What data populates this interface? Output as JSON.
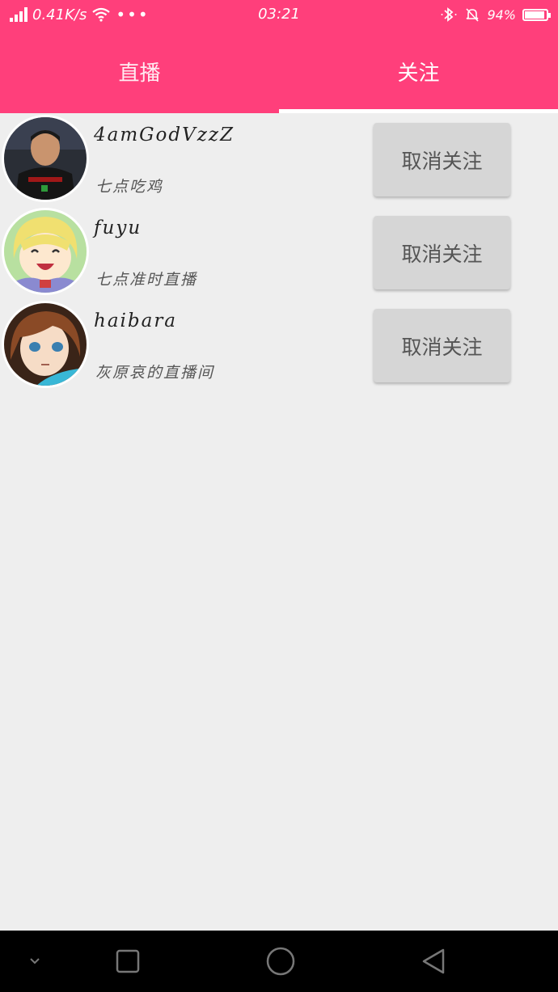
{
  "status_bar": {
    "network_speed": "0.41K/s",
    "more": "•••",
    "time": "03:21",
    "battery_percent": "94%",
    "battery_level": 0.94,
    "icons": [
      "signal-icon",
      "wifi-icon",
      "bluetooth-icon",
      "silent-bell-icon",
      "battery-icon"
    ]
  },
  "tabs": [
    {
      "label": "直播",
      "active": false
    },
    {
      "label": "关注",
      "active": true
    }
  ],
  "follow_list": [
    {
      "name": "4amGodVzzZ",
      "description": "七点吃鸡",
      "button_label": "取消关注",
      "avatar": "man-avatar"
    },
    {
      "name": "fuyu",
      "description": "七点准时直播",
      "button_label": "取消关注",
      "avatar": "anime-girl-blonde-avatar"
    },
    {
      "name": "haibara",
      "description": "灰原哀的直播间",
      "button_label": "取消关注",
      "avatar": "anime-girl-brown-hair-avatar"
    }
  ],
  "nav_bar": {
    "icons": [
      "chevron-down-icon",
      "recent-apps-icon",
      "home-icon",
      "back-icon"
    ]
  },
  "colors": {
    "accent": "#ff3f7b",
    "background": "#eeeeee",
    "button": "#d6d6d6"
  }
}
